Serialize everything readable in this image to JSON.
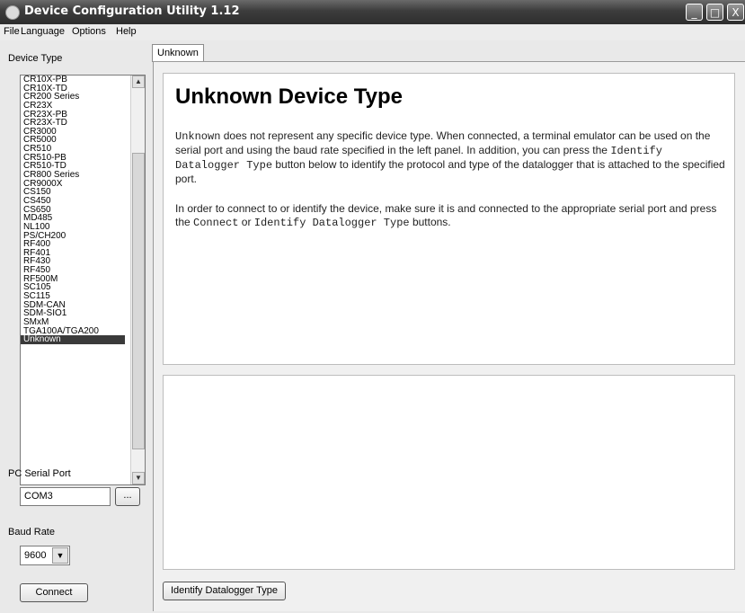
{
  "window": {
    "title": "Device Configuration Utility 1.12",
    "controls": {
      "minimize": "_",
      "maximize": "□",
      "close": "X"
    }
  },
  "menu": [
    "File",
    "Language",
    "Options",
    "Help"
  ],
  "left_panel": {
    "device_type_label": "Device Type",
    "devices": [
      "CR10X-PB",
      "CR10X-TD",
      "CR200 Series",
      "CR23X",
      "CR23X-PB",
      "CR23X-TD",
      "CR3000",
      "CR5000",
      "CR510",
      "CR510-PB",
      "CR510-TD",
      "CR800 Series",
      "CR9000X",
      "CS150",
      "CS450",
      "CS650",
      "MD485",
      "NL100",
      "PS/CH200",
      "RF400",
      "RF401",
      "RF430",
      "RF450",
      "RF500M",
      "SC105",
      "SC115",
      "SDM-CAN",
      "SDM-SIO1",
      "SMxM",
      "TGA100A/TGA200",
      "Unknown"
    ],
    "selected_device": "Unknown",
    "serial_port_label": "PC Serial Port",
    "serial_port_value": "COM3",
    "browse_button": "...",
    "baud_rate_label": "Baud Rate",
    "baud_rate_value": "9600",
    "connect_button": "Connect"
  },
  "tabs": [
    {
      "label": "Unknown"
    }
  ],
  "info": {
    "heading": "Unknown Device Type",
    "p1": {
      "code1": "Unknown",
      "text1": " does not represent any specific device type. When connected, a terminal emulator can be used on the serial port and using the baud rate specified in the left panel. In addition, you can press the ",
      "code2": "Identify Datalogger Type",
      "text2": " button below to identify the protocol and type of the datalogger that is attached to the specified port."
    },
    "p2": {
      "text1": "In order to connect to or identify the device, make sure it is and connected to the appropriate serial port and press the ",
      "code1": "Connect",
      "text2": " or ",
      "code2": "Identify Datalogger Type",
      "text3": " buttons."
    }
  },
  "identify_button": "Identify Datalogger Type",
  "colors": {
    "selection": "#3a3a3a",
    "titlebar": "#3c3c3c"
  }
}
